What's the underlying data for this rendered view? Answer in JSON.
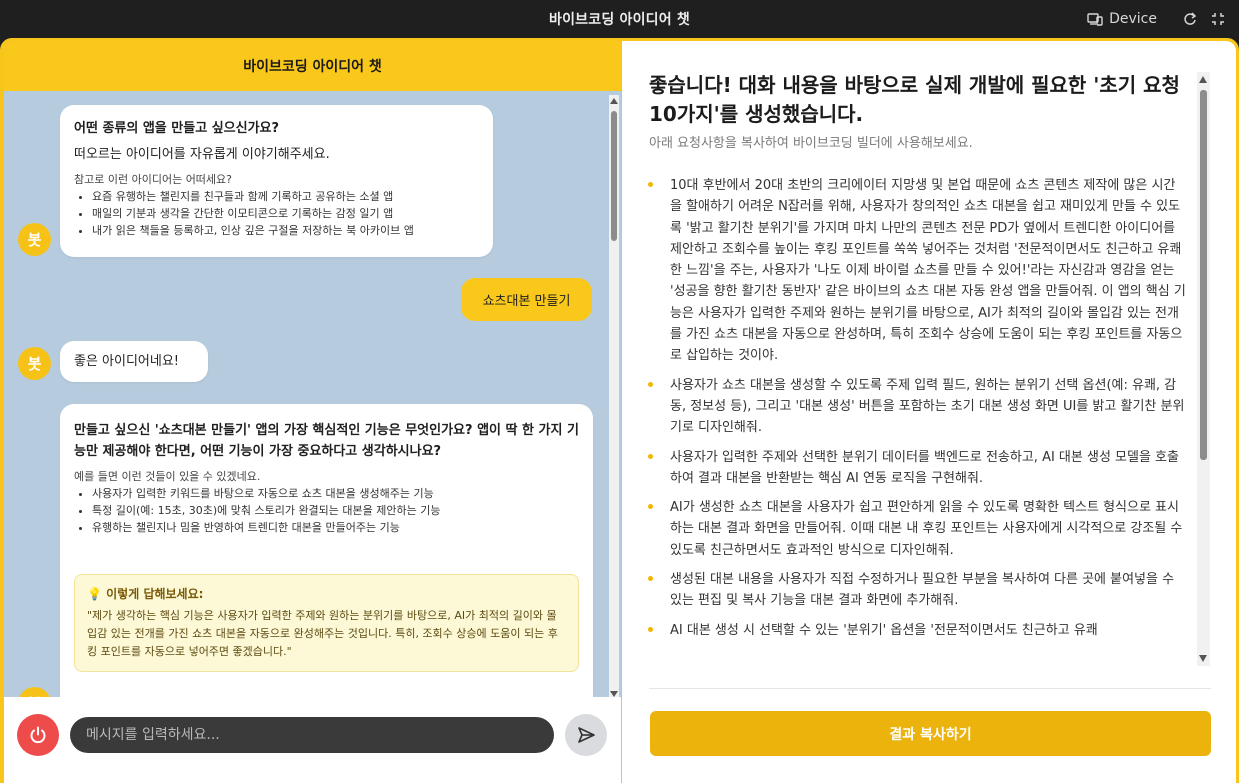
{
  "window": {
    "title": "바이브코딩 아이디어 챗",
    "device_label": "Device"
  },
  "chat": {
    "header_title": "바이브코딩 아이디어 챗",
    "bot_avatar_label": "봇",
    "messages": {
      "m1": {
        "title": "어떤 종류의 앱을 만들고 싶으신가요?",
        "text": "떠오르는 아이디어를 자유롭게 이야기해주세요.",
        "small": "참고로 이런 아이디어는 어떠세요?",
        "list": [
          "요즘 유행하는 챌린지를 친구들과 함께 기록하고 공유하는 소셜 앱",
          "매일의 기분과 생각을 간단한 이모티콘으로 기록하는 감정 일기 앱",
          "내가 읽은 책들을 등록하고, 인상 깊은 구절을 저장하는 북 아카이브 앱"
        ]
      },
      "u1": "쇼츠대본 만들기",
      "m2": "좋은 아이디어네요!",
      "m3": {
        "title": "만들고 싶으신 '쇼츠대본 만들기' 앱의 가장 핵심적인 기능은 무엇인가요? 앱이 딱 한 가지 기능만 제공해야 한다면, 어떤 기능이 가장 중요하다고 생각하시나요?",
        "small": "예를 들면 이런 것들이 있을 수 있겠네요.",
        "list": [
          "사용자가 입력한 키워드를 바탕으로 자동으로 쇼츠 대본을 생성해주는 기능",
          "특정 길이(예: 15초, 30초)에 맞춰 스토리가 완결되는 대본을 제안하는 기능",
          "유행하는 챌린지나 밈을 반영하여 트렌디한 대본을 만들어주는 기능"
        ],
        "hint_title": "이렇게 답해보세요:",
        "hint_text": "\"제가 생각하는 핵심 기능은 사용자가 입력한 주제와 원하는 분위기를 바탕으로, AI가 최적의 길이와 몰입감 있는 전개를 가진 쇼츠 대본을 자동으로 완성해주는 것입니다. 특히, 조회수 상승에 도움이 되는 후킹 포인트를 자동으로 넣어주면 좋겠습니다.\""
      }
    },
    "input_placeholder": "메시지를 입력하세요..."
  },
  "result": {
    "title": "좋습니다! 대화 내용을 바탕으로 실제 개발에 필요한 '초기 요청 10가지'를 생성했습니다.",
    "subtitle": "아래 요청사항을 복사하여 바이브코딩 빌더에 사용해보세요.",
    "items": [
      "10대 후반에서 20대 초반의 크리에이터 지망생 및 본업 때문에 쇼츠 콘텐츠 제작에 많은 시간을 할애하기 어려운 N잡러를 위해, 사용자가 창의적인 쇼츠 대본을 쉽고 재미있게 만들 수 있도록 '밝고 활기찬 분위기'를 가지며 마치 나만의 콘텐츠 전문 PD가 옆에서 트렌디한 아이디어를 제안하고 조회수를 높이는 후킹 포인트를 쏙쏙 넣어주는 것처럼 '전문적이면서도 친근하고 유쾌한 느낌'을 주는, 사용자가 '나도 이제 바이럴 쇼츠를 만들 수 있어!'라는 자신감과 영감을 얻는 '성공을 향한 활기찬 동반자' 같은 바이브의 쇼츠 대본 자동 완성 앱을 만들어줘. 이 앱의 핵심 기능은 사용자가 입력한 주제와 원하는 분위기를 바탕으로, AI가 최적의 길이와 몰입감 있는 전개를 가진 쇼츠 대본을 자동으로 완성하며, 특히 조회수 상승에 도움이 되는 후킹 포인트를 자동으로 삽입하는 것이야.",
      "사용자가 쇼츠 대본을 생성할 수 있도록 주제 입력 필드, 원하는 분위기 선택 옵션(예: 유쾌, 감동, 정보성 등), 그리고 '대본 생성' 버튼을 포함하는 초기 대본 생성 화면 UI를 밝고 활기찬 분위기로 디자인해줘.",
      "사용자가 입력한 주제와 선택한 분위기 데이터를 백엔드로 전송하고, AI 대본 생성 모델을 호출하여 결과 대본을 반환받는 핵심 AI 연동 로직을 구현해줘.",
      "AI가 생성한 쇼츠 대본을 사용자가 쉽고 편안하게 읽을 수 있도록 명확한 텍스트 형식으로 표시하는 대본 결과 화면을 만들어줘. 이때 대본 내 후킹 포인트는 사용자에게 시각적으로 강조될 수 있도록 친근하면서도 효과적인 방식으로 디자인해줘.",
      "생성된 대본 내용을 사용자가 직접 수정하거나 필요한 부분을 복사하여 다른 곳에 붙여넣을 수 있는 편집 및 복사 기능을 대본 결과 화면에 추가해줘.",
      "AI 대본 생성 시 선택할 수 있는 '분위기' 옵션을 '전문적이면서도 친근하고 유쾌"
    ],
    "copy_button_label": "결과 복사하기"
  },
  "colors": {
    "accent": "#f9c81a",
    "button": "#ebb30b",
    "chat_bg": "#b6cbdd",
    "power": "#ee4b4b"
  },
  "icons": [
    "device-icon",
    "refresh-icon",
    "fullscreen-icon",
    "power-icon",
    "send-icon",
    "lightbulb-icon"
  ]
}
